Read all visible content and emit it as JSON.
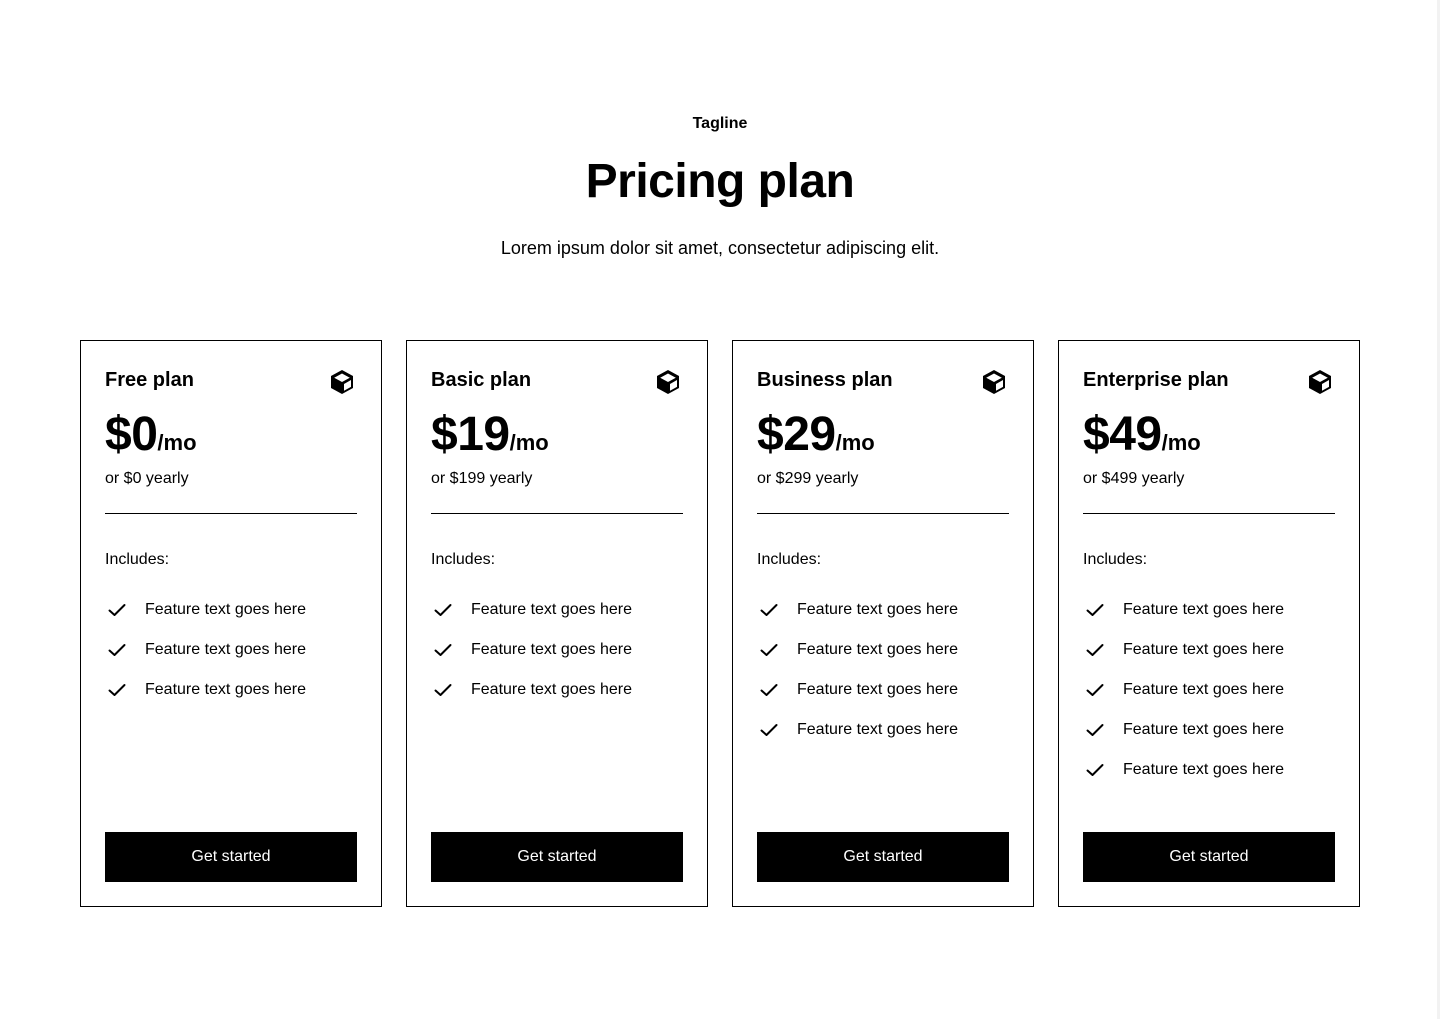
{
  "header": {
    "tagline": "Tagline",
    "title": "Pricing plan",
    "subtitle": "Lorem ipsum dolor sit amet, consectetur adipiscing elit."
  },
  "plans": [
    {
      "name": "Free plan",
      "icon": "cube-icon",
      "price": "$0",
      "period": "/mo",
      "yearly": "or $0 yearly",
      "includes_label": "Includes:",
      "features": [
        "Feature text goes here",
        "Feature text goes here",
        "Feature text goes here"
      ],
      "cta": "Get started"
    },
    {
      "name": "Basic plan",
      "icon": "cube-icon",
      "price": "$19",
      "period": "/mo",
      "yearly": "or $199 yearly",
      "includes_label": "Includes:",
      "features": [
        "Feature text goes here",
        "Feature text goes here",
        "Feature text goes here"
      ],
      "cta": "Get started"
    },
    {
      "name": "Business plan",
      "icon": "cube-icon",
      "price": "$29",
      "period": "/mo",
      "yearly": "or $299 yearly",
      "includes_label": "Includes:",
      "features": [
        "Feature text goes here",
        "Feature text goes here",
        "Feature text goes here",
        "Feature text goes here"
      ],
      "cta": "Get started"
    },
    {
      "name": "Enterprise plan",
      "icon": "cube-icon",
      "price": "$49",
      "period": "/mo",
      "yearly": "or $499 yearly",
      "includes_label": "Includes:",
      "features": [
        "Feature text goes here",
        "Feature text goes here",
        "Feature text goes here",
        "Feature text goes here",
        "Feature text goes here"
      ],
      "cta": "Get started"
    }
  ],
  "colors": {
    "text": "#000000",
    "background": "#ffffff",
    "button_bg": "#000000",
    "button_text": "#ffffff"
  }
}
